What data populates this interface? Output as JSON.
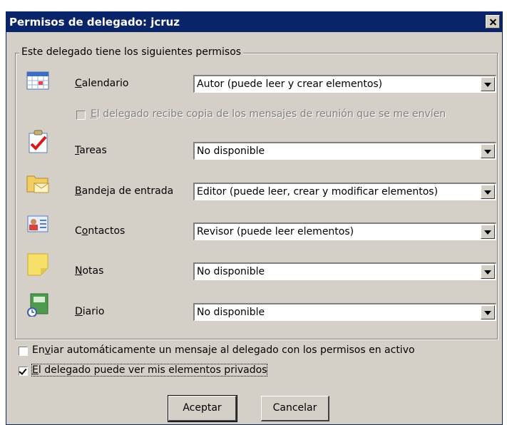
{
  "window": {
    "title": "Permisos de delegado: jcruz"
  },
  "group": {
    "legend": "Este delegado tiene los siguientes permisos"
  },
  "rows": [
    {
      "key": "C",
      "label_rest": "alendario",
      "value": "Autor (puede leer y crear elementos)",
      "icon": "calendar-icon"
    },
    {
      "key": "T",
      "label_rest": "areas",
      "value": "No disponible",
      "icon": "tasks-icon"
    },
    {
      "key": "B",
      "label_rest": "andeja de entrada",
      "value": "Editor (puede leer, crear y modificar elementos)",
      "icon": "inbox-icon"
    },
    {
      "key": "C",
      "label_pre": "",
      "label_mid": "o",
      "label_rest": "ntactos",
      "value": "Revisor (puede leer elementos)",
      "icon": "contacts-icon"
    },
    {
      "key": "N",
      "label_rest": "otas",
      "value": "No disponible",
      "icon": "notes-icon"
    },
    {
      "key": "D",
      "label_rest": "iario",
      "value": "No disponible",
      "icon": "journal-icon"
    }
  ],
  "meeting_copy": {
    "key": "E",
    "rest": "l delegado recibe copia de los mensajes de reunión que se me envíen",
    "checked": false,
    "enabled": false
  },
  "auto_message": {
    "pre": "En",
    "key": "v",
    "rest": "iar automáticamente un mensaje al delegado con los permisos en activo",
    "checked": false
  },
  "private_items": {
    "key": "E",
    "rest": "l delegado puede ver mis elementos privados",
    "checked": true
  },
  "buttons": {
    "ok": "Aceptar",
    "cancel": "Cancelar"
  }
}
